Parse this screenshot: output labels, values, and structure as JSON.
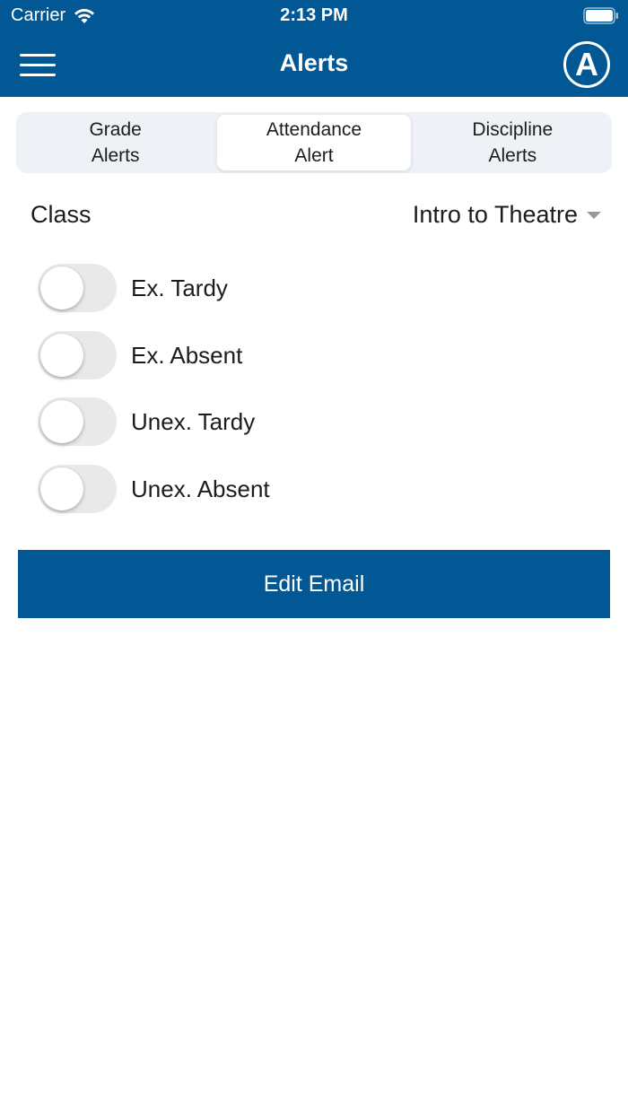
{
  "status_bar": {
    "carrier": "Carrier",
    "time": "2:13 PM"
  },
  "header": {
    "title": "Alerts",
    "avatar_letter": "A",
    "background": "#025894"
  },
  "tabs": [
    {
      "label": "Grade\nAlerts",
      "selected": false
    },
    {
      "label": "Attendance\nAlert",
      "selected": true
    },
    {
      "label": "Discipline\nAlerts",
      "selected": false
    }
  ],
  "class_picker": {
    "label": "Class",
    "selected_value": "Intro to Theatre"
  },
  "toggles": [
    {
      "label": "Ex. Tardy",
      "on": false
    },
    {
      "label": "Ex. Absent",
      "on": false
    },
    {
      "label": "Unex. Tardy",
      "on": false
    },
    {
      "label": "Unex. Absent",
      "on": false
    }
  ],
  "edit_email_button": {
    "label": "Edit Email"
  }
}
